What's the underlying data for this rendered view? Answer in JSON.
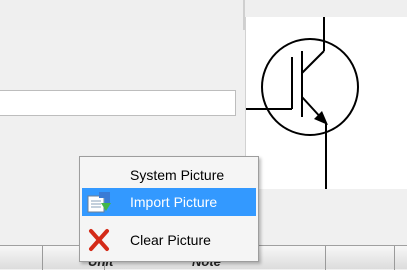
{
  "grid": {
    "columns": [
      "Unit",
      "Note"
    ]
  },
  "context_menu": {
    "items": [
      {
        "label": "System Picture",
        "icon": "none",
        "highlighted": false
      },
      {
        "label": "Import Picture",
        "icon": "import-picture-icon",
        "highlighted": true
      },
      {
        "label": "Clear Picture",
        "icon": "red-x-icon",
        "highlighted": false
      }
    ]
  },
  "colors": {
    "highlight": "#3399ff",
    "clear_icon": "#d42a18",
    "picture_arrow": "#000000"
  }
}
